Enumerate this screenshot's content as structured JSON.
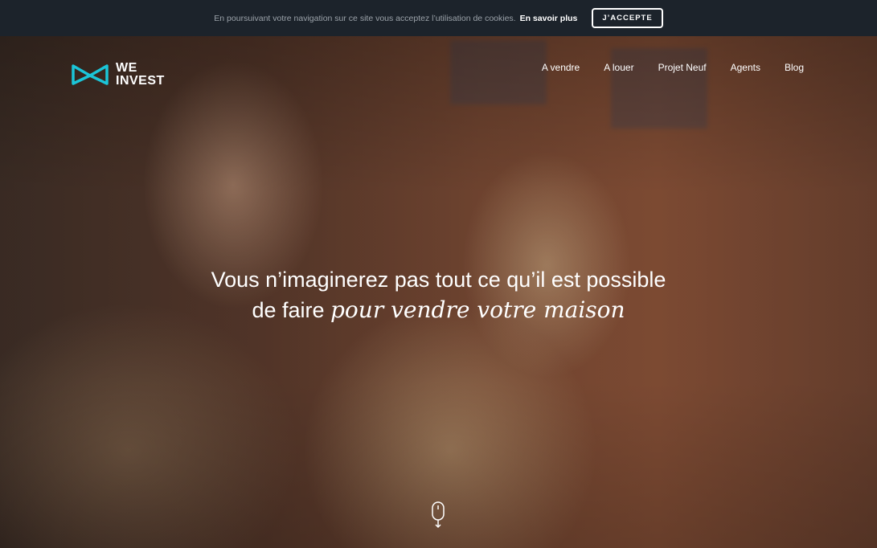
{
  "cookie_bar": {
    "message": "En poursuivant votre navigation sur ce site vous acceptez l’utilisation de cookies.",
    "link_label": "En savoir plus",
    "accept_label": "J’ACCEPTE"
  },
  "brand": {
    "line1": "WE",
    "line2": "INVEST",
    "accent_color": "#1bc5d8"
  },
  "nav": {
    "items": [
      {
        "label": "A vendre"
      },
      {
        "label": "A louer"
      },
      {
        "label": "Projet Neuf"
      },
      {
        "label": "Agents"
      },
      {
        "label": "Blog"
      }
    ]
  },
  "hero": {
    "line1": "Vous n’imaginerez pas tout ce qu’il est possible",
    "line2_prefix": "de faire ",
    "line2_emphasis": "pour vendre votre maison"
  },
  "icons": {
    "logo": "bowtie-logo-icon",
    "scroll": "scroll-mouse-icon"
  }
}
